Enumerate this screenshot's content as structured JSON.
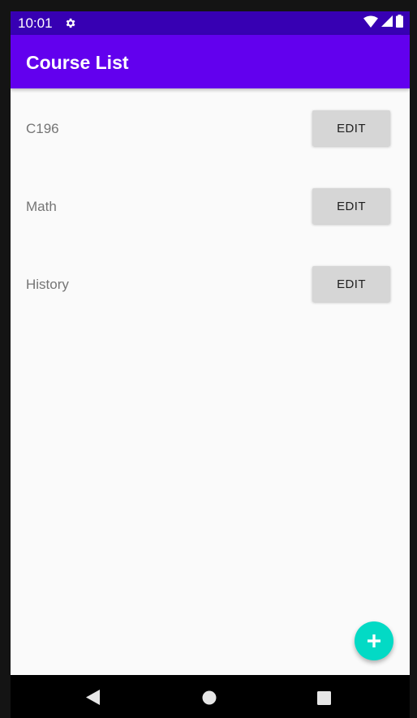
{
  "status_bar": {
    "time": "10:01",
    "icons": [
      "settings-icon",
      "wifi-icon",
      "signal-icon",
      "battery-icon"
    ]
  },
  "app_bar": {
    "title": "Course List"
  },
  "courses": [
    {
      "name": "C196",
      "edit_label": "EDIT"
    },
    {
      "name": "Math",
      "edit_label": "EDIT"
    },
    {
      "name": "History",
      "edit_label": "EDIT"
    }
  ],
  "fab": {
    "icon": "plus-icon"
  },
  "nav_bar": {
    "icons": [
      "back-icon",
      "home-icon",
      "recents-icon"
    ]
  },
  "colors": {
    "status_bar": "#3700b3",
    "app_bar": "#6200ee",
    "fab": "#03dac5",
    "edit_button": "#d6d6d6",
    "background": "#fafafa"
  }
}
